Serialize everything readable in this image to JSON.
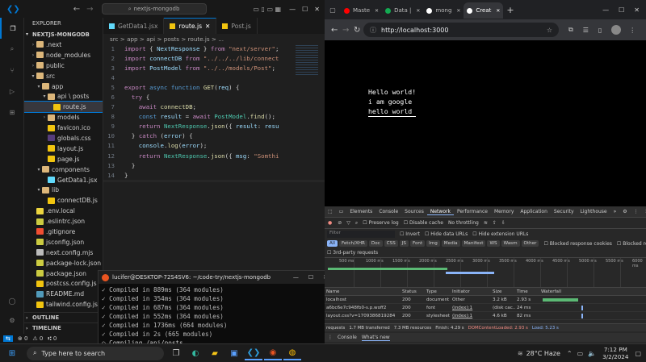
{
  "vscode": {
    "nav_back": "←",
    "nav_forward": "→",
    "search": "nextjs-mongodb",
    "explorer_label": "EXPLORER",
    "project": "NEXTJS-MONGODB",
    "tree": [
      {
        "label": ".next",
        "depth": 1,
        "type": "folder",
        "open": false
      },
      {
        "label": "node_modules",
        "depth": 1,
        "type": "folder",
        "open": false
      },
      {
        "label": "public",
        "depth": 1,
        "type": "folder",
        "open": false
      },
      {
        "label": "src",
        "depth": 1,
        "type": "folder",
        "open": true
      },
      {
        "label": "app",
        "depth": 2,
        "type": "folder",
        "open": true
      },
      {
        "label": "api \\ posts",
        "depth": 3,
        "type": "folder",
        "open": true
      },
      {
        "label": "route.js",
        "depth": 4,
        "type": "js",
        "selected": true
      },
      {
        "label": "models",
        "depth": 3,
        "type": "folder",
        "open": false
      },
      {
        "label": "favicon.ico",
        "depth": 3,
        "type": "ico"
      },
      {
        "label": "globals.css",
        "depth": 3,
        "type": "css"
      },
      {
        "label": "layout.js",
        "depth": 3,
        "type": "js"
      },
      {
        "label": "page.js",
        "depth": 3,
        "type": "js"
      },
      {
        "label": "components",
        "depth": 2,
        "type": "folder",
        "open": true
      },
      {
        "label": "GetData1.jsx",
        "depth": 3,
        "type": "jsx"
      },
      {
        "label": "lib",
        "depth": 2,
        "type": "folder",
        "open": true
      },
      {
        "label": "connectDB.js",
        "depth": 3,
        "type": "js"
      },
      {
        "label": ".env.local",
        "depth": 1,
        "type": "env"
      },
      {
        "label": ".eslintrc.json",
        "depth": 1,
        "type": "json"
      },
      {
        "label": ".gitignore",
        "depth": 1,
        "type": "git"
      },
      {
        "label": "jsconfig.json",
        "depth": 1,
        "type": "json"
      },
      {
        "label": "next.config.mjs",
        "depth": 1,
        "type": "next"
      },
      {
        "label": "package-lock.json",
        "depth": 1,
        "type": "json"
      },
      {
        "label": "package.json",
        "depth": 1,
        "type": "json"
      },
      {
        "label": "postcss.config.js",
        "depth": 1,
        "type": "js"
      },
      {
        "label": "README.md",
        "depth": 1,
        "type": "md"
      },
      {
        "label": "tailwind.config.js",
        "depth": 1,
        "type": "js"
      }
    ],
    "outline": "OUTLINE",
    "timeline": "TIMELINE",
    "tabs": [
      {
        "label": "GetData1.jsx",
        "active": false
      },
      {
        "label": "route.js",
        "active": true
      },
      {
        "label": "Post.js",
        "active": false
      }
    ],
    "breadcrumb": "src > app > api > posts > route.js > ...",
    "code": [
      [
        [
          "import ",
          "kw"
        ],
        [
          "{ ",
          "pl"
        ],
        [
          "NextResponse",
          "vr"
        ],
        [
          " } ",
          "pl"
        ],
        [
          "from ",
          "kw"
        ],
        [
          "\"next/server\"",
          "st"
        ],
        [
          ";",
          "pl"
        ]
      ],
      [
        [
          "import ",
          "kw"
        ],
        [
          "connectDB ",
          "vr"
        ],
        [
          "from ",
          "kw"
        ],
        [
          "\"../../../lib/connect",
          "st"
        ]
      ],
      [
        [
          "import ",
          "kw"
        ],
        [
          "PostModel ",
          "vr"
        ],
        [
          "from ",
          "kw"
        ],
        [
          "\"../../models/Post\"",
          "st"
        ],
        [
          ";",
          "pl"
        ]
      ],
      [],
      [
        [
          "export ",
          "kw"
        ],
        [
          "async ",
          "kb"
        ],
        [
          "function ",
          "kb"
        ],
        [
          "GET",
          "fn"
        ],
        [
          "(",
          "pl"
        ],
        [
          "req",
          "vr"
        ],
        [
          ") {",
          "pl"
        ]
      ],
      [
        [
          "  try ",
          "kw"
        ],
        [
          "{",
          "pl"
        ]
      ],
      [
        [
          "    await ",
          "kw"
        ],
        [
          "connectDB",
          "fn"
        ],
        [
          ";",
          "pl"
        ]
      ],
      [
        [
          "    const ",
          "kb"
        ],
        [
          "result ",
          "vr"
        ],
        [
          "= ",
          "pl"
        ],
        [
          "await ",
          "kw"
        ],
        [
          "PostModel",
          "ty"
        ],
        [
          ".",
          "pl"
        ],
        [
          "find",
          "fn"
        ],
        [
          "();",
          "pl"
        ]
      ],
      [
        [
          "    return ",
          "kw"
        ],
        [
          "NextResponse",
          "ty"
        ],
        [
          ".",
          "pl"
        ],
        [
          "json",
          "fn"
        ],
        [
          "({ ",
          "pl"
        ],
        [
          "result",
          "vr"
        ],
        [
          ": ",
          "pl"
        ],
        [
          "resu",
          "vr"
        ]
      ],
      [
        [
          "  } ",
          "pl"
        ],
        [
          "catch ",
          "kw"
        ],
        [
          "(",
          "pl"
        ],
        [
          "error",
          "vr"
        ],
        [
          ") {",
          "pl"
        ]
      ],
      [
        [
          "    console",
          "vr"
        ],
        [
          ".",
          "pl"
        ],
        [
          "log",
          "fn"
        ],
        [
          "(",
          "pl"
        ],
        [
          "error",
          "vr"
        ],
        [
          ");",
          "pl"
        ]
      ],
      [
        [
          "    return ",
          "kw"
        ],
        [
          "NextResponse",
          "ty"
        ],
        [
          ".",
          "pl"
        ],
        [
          "json",
          "fn"
        ],
        [
          "({ ",
          "pl"
        ],
        [
          "msg",
          "vr"
        ],
        [
          ": ",
          "pl"
        ],
        [
          "\"Somthi",
          "st"
        ]
      ],
      [
        [
          "  }",
          "pl"
        ]
      ],
      [
        [
          "}",
          "pl"
        ]
      ],
      []
    ],
    "status": {
      "errors": "⊗ 0",
      "warnings": "⚠ 0",
      "ports": "⑆ 0"
    }
  },
  "terminal": {
    "title": "lucifer@DESKTOP-72S4SV6: ~/code-try/nextjs-mongodb",
    "lines": [
      "✓ Compiled in 889ms (364 modules)",
      "✓ Compiled in 354ms (364 modules)",
      "✓ Compiled in 687ms (364 modules)",
      "✓ Compiled in 552ms (364 modules)",
      "✓ Compiled in 1736ms (664 modules)",
      "✓ Compiled in 2s (665 modules)",
      "○ Compiling /api/posts ...",
      "  Compiled /api/posts in 1669ms (332 modules)"
    ]
  },
  "browser": {
    "tabs": [
      {
        "label": "Maste",
        "active": false
      },
      {
        "label": "Data |",
        "active": false
      },
      {
        "label": "mong",
        "active": false
      },
      {
        "label": "Creat",
        "active": true
      }
    ],
    "url": "http://localhost:3000",
    "page_lines": [
      "Hello world!",
      "i am google",
      "hello world"
    ]
  },
  "devtools": {
    "tabs": [
      "Elements",
      "Console",
      "Sources",
      "Network",
      "Performance",
      "Memory",
      "Application",
      "Security",
      "Lighthouse"
    ],
    "active_tab": "Network",
    "preserve_log": "Preserve log",
    "disable_cache": "Disable cache",
    "throttle": "No throttling",
    "filter_placeholder": "Filter",
    "invert": "Invert",
    "hide_data": "Hide data URLs",
    "hide_ext": "Hide extension URLs",
    "type_filters": [
      "All",
      "Fetch/XHR",
      "Doc",
      "CSS",
      "JS",
      "Font",
      "Img",
      "Media",
      "Manifest",
      "WS",
      "Wasm",
      "Other"
    ],
    "blocked_cookies": "Blocked response cookies",
    "blocked_requests": "Blocked requests",
    "third_party": "3rd-party requests",
    "timeline_ticks": [
      "500 ms",
      "1000 ms",
      "1500 ms",
      "2000 ms",
      "2500 ms",
      "3000 ms",
      "3500 ms",
      "4000 ms",
      "4500 ms",
      "5000 ms",
      "5500 ms",
      "6000 ms"
    ],
    "columns": [
      "Name",
      "Status",
      "Type",
      "Initiator",
      "Size",
      "Time",
      "Waterfall"
    ],
    "rows": [
      {
        "name": "localhost",
        "status": "200",
        "type": "document",
        "initiator": "Other",
        "size": "3.2 kB",
        "time": "2.93 s"
      },
      {
        "name": "a6bc6e7c948fb0-s.p.woff2",
        "status": "200",
        "type": "font",
        "initiator": "(index):1",
        "size": "(disk cac...",
        "time": "24 ms"
      },
      {
        "name": "layout.css?v=1709386819284",
        "status": "200",
        "type": "stylesheet",
        "initiator": "(index):1",
        "size": "4.6 kB",
        "time": "82 ms"
      }
    ],
    "summary": [
      "requests",
      "1.7 MB transferred",
      "7.3 MB resources",
      "Finish: 4.29 s",
      "DOMContentLoaded: 2.93 s",
      "Load: 5.23 s"
    ],
    "drawer": [
      "Console",
      "What's new"
    ]
  },
  "taskbar": {
    "search": "Type here to search",
    "weather": "28°C  Haze",
    "time": "7:12 PM",
    "date": "3/2/2024"
  }
}
